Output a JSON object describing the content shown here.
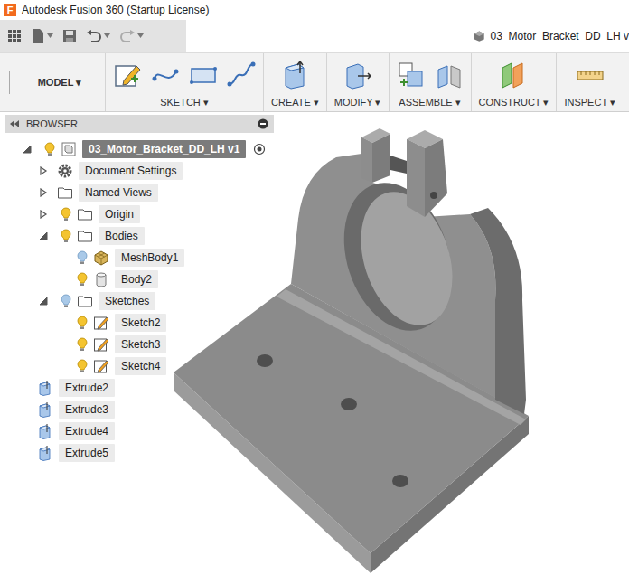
{
  "window": {
    "title": "Autodesk Fusion 360 (Startup License)",
    "app_icon": "F"
  },
  "document_tab": {
    "label": "03_Motor_Bracket_DD_LH v"
  },
  "workspace": {
    "label": "MODEL ▾"
  },
  "toolbar": [
    {
      "label": "SKETCH ▾",
      "tools": [
        "create-sketch",
        "arc",
        "rectangle",
        "spline"
      ]
    },
    {
      "label": "CREATE ▾",
      "tools": [
        "extrude"
      ]
    },
    {
      "label": "MODIFY ▾",
      "tools": [
        "press-pull"
      ]
    },
    {
      "label": "ASSEMBLE ▾",
      "tools": [
        "new-component",
        "joint"
      ]
    },
    {
      "label": "CONSTRUCT ▾",
      "tools": [
        "offset-plane"
      ]
    },
    {
      "label": "INSPECT ▾",
      "tools": [
        "measure"
      ]
    }
  ],
  "browser": {
    "title": "BROWSER",
    "items": [
      {
        "name": "03_Motor_Bracket_DD_LH v1",
        "depth": 0,
        "kind": "component",
        "expanded": true,
        "visible": true,
        "selected": true
      },
      {
        "name": "Document Settings",
        "depth": 1,
        "kind": "settings",
        "expanded": false,
        "visible": null,
        "selected": false
      },
      {
        "name": "Named Views",
        "depth": 1,
        "kind": "folder",
        "expanded": false,
        "visible": null,
        "selected": false
      },
      {
        "name": "Origin",
        "depth": 1,
        "kind": "folder",
        "expanded": false,
        "visible": true,
        "selected": false
      },
      {
        "name": "Bodies",
        "depth": 1,
        "kind": "folder",
        "expanded": true,
        "visible": true,
        "selected": false
      },
      {
        "name": "MeshBody1",
        "depth": 2,
        "kind": "mesh",
        "expanded": null,
        "visible": false,
        "selected": false
      },
      {
        "name": "Body2",
        "depth": 2,
        "kind": "body",
        "expanded": null,
        "visible": true,
        "selected": false
      },
      {
        "name": "Sketches",
        "depth": 1,
        "kind": "folder",
        "expanded": true,
        "visible": false,
        "selected": false
      },
      {
        "name": "Sketch2",
        "depth": 2,
        "kind": "sketch",
        "expanded": null,
        "visible": true,
        "selected": false
      },
      {
        "name": "Sketch3",
        "depth": 2,
        "kind": "sketch",
        "expanded": null,
        "visible": true,
        "selected": false
      },
      {
        "name": "Sketch4",
        "depth": 2,
        "kind": "sketch",
        "expanded": null,
        "visible": true,
        "selected": false
      },
      {
        "name": "Extrude2",
        "depth": 1,
        "kind": "extrude",
        "expanded": null,
        "visible": null,
        "selected": false
      },
      {
        "name": "Extrude3",
        "depth": 1,
        "kind": "extrude",
        "expanded": null,
        "visible": null,
        "selected": false
      },
      {
        "name": "Extrude4",
        "depth": 1,
        "kind": "extrude",
        "expanded": null,
        "visible": null,
        "selected": false
      },
      {
        "name": "Extrude5",
        "depth": 1,
        "kind": "extrude",
        "expanded": null,
        "visible": null,
        "selected": false
      }
    ]
  }
}
